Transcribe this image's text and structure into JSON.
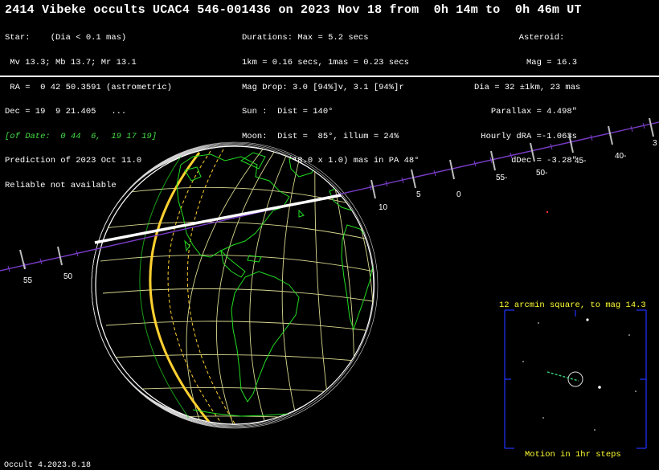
{
  "title": "2414 Vibeke occults UCAC4 546-001436 on 2023 Nov 18 from  0h 14m to  0h 46m UT",
  "star": {
    "lines": [
      "Star:    (Dia < 0.1 mas)",
      " Mv 13.3; Mb 13.7; Mr 13.1",
      " RA =  0 42 50.3591 (astrometric)",
      "Dec = 19  9 21.405   ...",
      "[of Date:  0 44  6,  19 17 19]",
      "Prediction of 2023 Oct 11.0",
      "Reliable not available"
    ]
  },
  "event": {
    "lines": [
      "Durations: Max = 5.2 secs",
      "1km = 0.16 secs, 1mas = 0.23 secs",
      "Mag Drop: 3.0 [94%]v, 3.1 [94%]r",
      "Sun :  Dist = 140°",
      "Moon:  Dist =  85°, illum = 24%",
      "1σ Err: ±(18.0 x 1.0) mas in PA 48°"
    ]
  },
  "asteroid": {
    "lines": [
      "Asteroid:",
      "Mag = 16.3",
      "Dia = 32 ±1km, 23 mas",
      "Parallax = 4.498\"",
      "Hourly dRA =-1.063s",
      "dDec = -3.28\""
    ]
  },
  "path_ticks": {
    "labels": [
      "55",
      "50",
      "10",
      "5",
      "0",
      "55-",
      "50-",
      "45-",
      "40-",
      "3"
    ]
  },
  "star_chart": {
    "title": "12 arcmin square, to mag 14.3",
    "caption": "Motion in 1hr steps"
  },
  "footer": "Occult 4.2023.8.18",
  "colors": {
    "background": "#000000",
    "coastlines": "#22dd22",
    "grid": "#d8d890",
    "path_line": "#7a3cc8",
    "shadow_path": "#ffffff",
    "terminator": "#ffd030",
    "chart_frame": "#2233ff",
    "chart_text": "#ffff33"
  }
}
